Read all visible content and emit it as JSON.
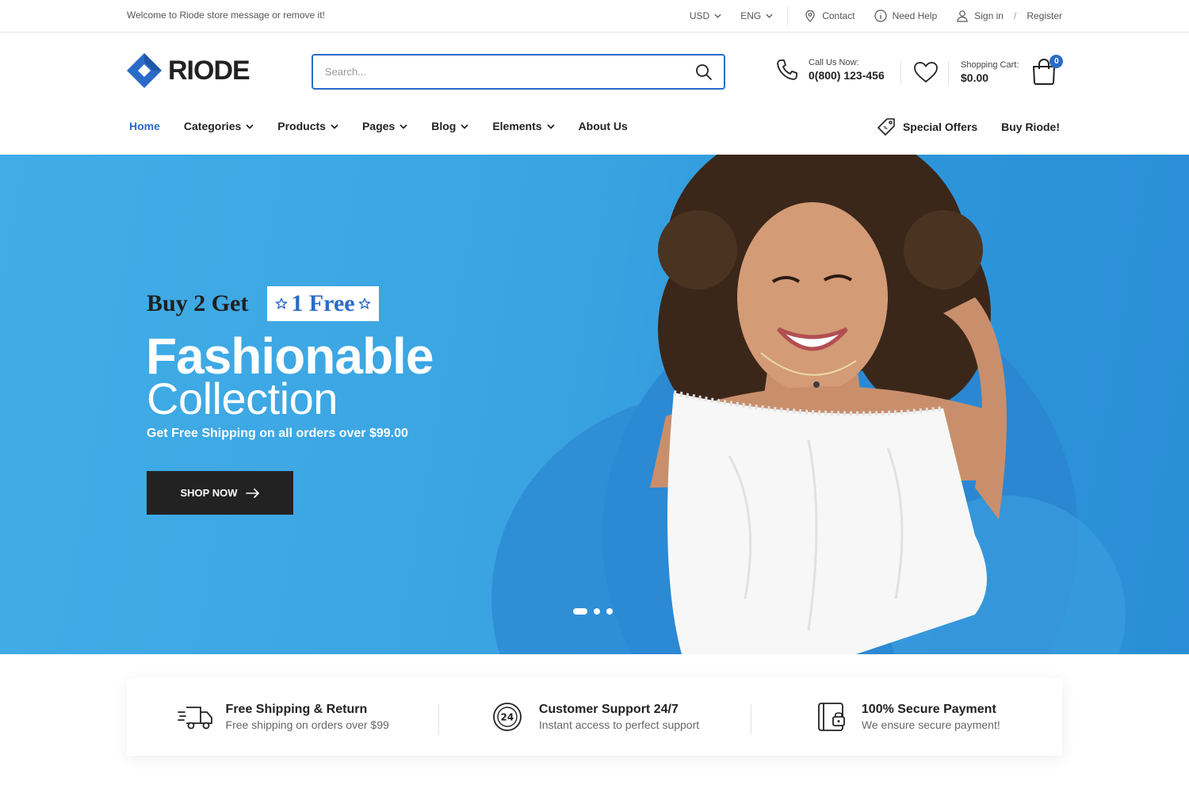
{
  "topbar": {
    "welcome": "Welcome to Riode store message or remove it!",
    "currency": "USD",
    "language": "ENG",
    "contact": "Contact",
    "help": "Need Help",
    "signin": "Sign in",
    "separator": "/",
    "register": "Register"
  },
  "header": {
    "logo_text": "RIODE",
    "search_placeholder": "Search...",
    "call_label": "Call Us Now:",
    "call_number": "0(800) 123-456",
    "cart_label": "Shopping Cart:",
    "cart_amount": "$0.00",
    "cart_count": "0"
  },
  "nav": {
    "items": [
      {
        "label": "Home",
        "active": true
      },
      {
        "label": "Categories"
      },
      {
        "label": "Products"
      },
      {
        "label": "Pages"
      },
      {
        "label": "Blog"
      },
      {
        "label": "Elements"
      },
      {
        "label": "About Us"
      }
    ],
    "special_offers": "Special Offers",
    "buy": "Buy Riode!"
  },
  "hero": {
    "promo_prefix": "Buy 2 Get",
    "promo_highlight": "1 Free",
    "title": "Fashionable",
    "subtitle": "Collection",
    "shipping_text": "Get Free Shipping on all orders over $99.00",
    "cta": "SHOP NOW",
    "slides": 3,
    "active_slide": 1
  },
  "features": [
    {
      "icon": "truck-icon",
      "title": "Free Shipping & Return",
      "desc": "Free shipping on orders over $99"
    },
    {
      "icon": "support-24-icon",
      "title": "Customer Support 24/7",
      "desc": "Instant access to perfect support"
    },
    {
      "icon": "secure-payment-icon",
      "title": "100% Secure Payment",
      "desc": "We ensure secure payment!"
    }
  ],
  "colors": {
    "accent": "#2a6bc8",
    "hero_bg": "#3aa4e2",
    "dark_button": "#222222"
  }
}
